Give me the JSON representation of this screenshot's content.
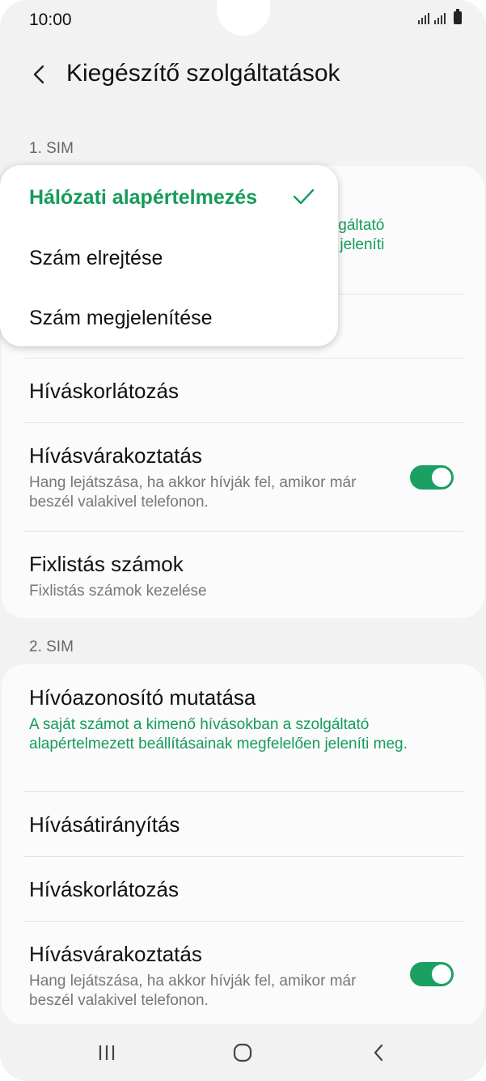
{
  "status_bar": {
    "time": "10:00"
  },
  "header": {
    "title": "Kiegészítő szolgáltatások",
    "back_icon": "chevron-left-icon"
  },
  "sim1": {
    "label": "1. SIM",
    "peek_line1": "zolgáltató",
    "peek_line2": "en jeleníti",
    "items": [
      {
        "title": "Híváskorlátozás"
      },
      {
        "title": "Hívásvárakoztatás",
        "subtitle": "Hang lejátszása, ha akkor hívják fel, amikor már beszél valakivel telefonon.",
        "toggle_on": true
      },
      {
        "title": "Fixlistás számok",
        "subtitle": "Fixlistás számok kezelése"
      }
    ]
  },
  "popup_menu": {
    "options": [
      {
        "label": "Hálózati alapértelmezés",
        "selected": true
      },
      {
        "label": "Szám elrejtése",
        "selected": false
      },
      {
        "label": "Szám megjelenítése",
        "selected": false
      }
    ]
  },
  "sim2": {
    "label": "2. SIM",
    "items": [
      {
        "title": "Hívóazonosító mutatása",
        "subtitle": "A saját számot a kimenő hívásokban a szolgáltató alapértelmezett beállításainak megfelelően jeleníti meg."
      },
      {
        "title": "Hívásátirányítás"
      },
      {
        "title": "Híváskorlátozás"
      },
      {
        "title": "Hívásvárakoztatás",
        "subtitle": "Hang lejátszása, ha akkor hívják fel, amikor már beszél valakivel telefonon.",
        "toggle_on": true
      }
    ]
  },
  "colors": {
    "accent": "#159b5b",
    "toggle_on": "#1aa063",
    "background": "#f2f2f2",
    "card": "#fbfbfb"
  },
  "navbar": {
    "icons": [
      "recent-apps-icon",
      "home-icon",
      "back-icon"
    ]
  }
}
